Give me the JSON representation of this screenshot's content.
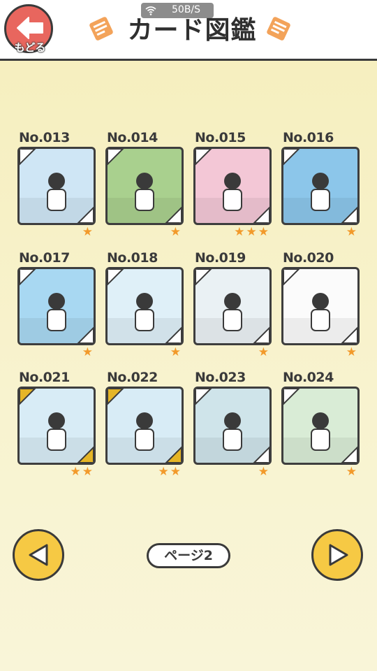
{
  "header": {
    "back_label": "もどる",
    "title": "カード図鑑",
    "status_speed": "50B/S"
  },
  "cards": [
    {
      "no": "No.013",
      "stars": "★",
      "bg": "#cfe6f5"
    },
    {
      "no": "No.014",
      "stars": "★",
      "bg": "#a9d08e"
    },
    {
      "no": "No.015",
      "stars": "★★★",
      "bg": "#f3c7d6"
    },
    {
      "no": "No.016",
      "stars": "★",
      "bg": "#8cc6ea"
    },
    {
      "no": "No.017",
      "stars": "★",
      "bg": "#a8d8f2"
    },
    {
      "no": "No.018",
      "stars": "★",
      "bg": "#dff0f8"
    },
    {
      "no": "No.019",
      "stars": "★",
      "bg": "#eaf1f4"
    },
    {
      "no": "No.020",
      "stars": "★",
      "bg": "#fbfbfb"
    },
    {
      "no": "No.021",
      "stars": "★★",
      "bg": "#d8ecf6"
    },
    {
      "no": "No.022",
      "stars": "★★",
      "bg": "#d8ecf6"
    },
    {
      "no": "No.023",
      "stars": "★",
      "bg": "#cfe4ea"
    },
    {
      "no": "No.024",
      "stars": "★",
      "bg": "#d9ecd6"
    }
  ],
  "pagination": {
    "page_label": "ページ2"
  },
  "colors": {
    "accent_yellow": "#f6c944",
    "back_red": "#e8665e",
    "star_orange": "#f29a2b",
    "gold_corner": "#e5b526"
  }
}
